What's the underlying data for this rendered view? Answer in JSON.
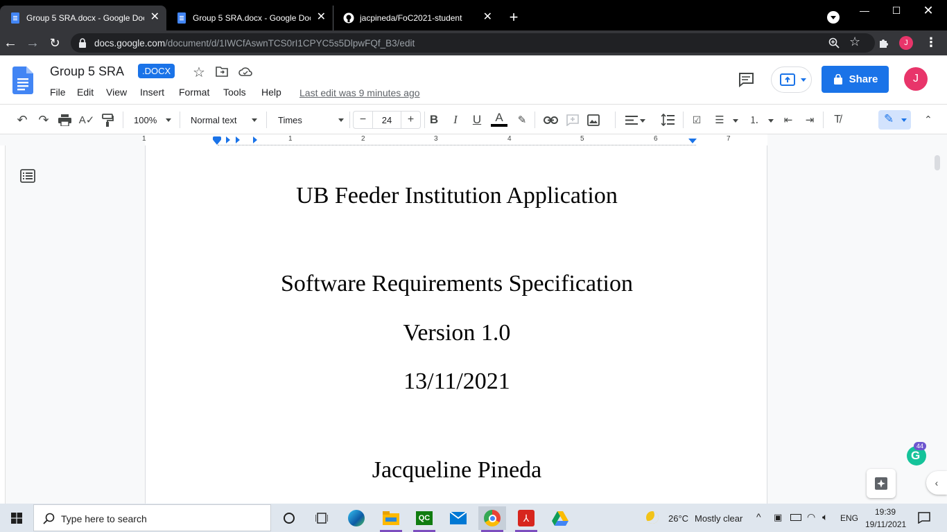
{
  "browser": {
    "tabs": [
      {
        "title": "Group 5 SRA.docx - Google Docs",
        "active": true
      },
      {
        "title": "Group 5 SRA.docx - Google Docs",
        "active": false
      },
      {
        "title": "jacpineda/FoC2021-student",
        "active": false
      }
    ],
    "new_tab_label": "+",
    "url_host": "docs.google.com",
    "url_path": "/document/d/1IWCfAswnTCS0rI1CPYC5s5DlpwFQf_B3/edit",
    "profile_initial": "J"
  },
  "docs": {
    "title": "Group 5 SRA",
    "badge": ".DOCX",
    "menu": [
      "File",
      "Edit",
      "View",
      "Insert",
      "Format",
      "Tools",
      "Help"
    ],
    "last_edit": "Last edit was 9 minutes ago",
    "share_label": "Share",
    "avatar_initial": "J",
    "accent_color": "#1a73e8"
  },
  "toolbar": {
    "zoom": "100%",
    "style": "Normal text",
    "font": "Times",
    "font_size": "24",
    "minus": "−",
    "plus": "+",
    "bold": "B",
    "italic": "I",
    "underline": "U",
    "text_color": "A"
  },
  "ruler": {
    "numbers": [
      "1",
      "1",
      "2",
      "3",
      "4",
      "5",
      "6",
      "7"
    ]
  },
  "document": {
    "lines": [
      "UB Feeder Institution Application",
      "Software Requirements Specification",
      "Version 1.0",
      "13/11/2021",
      "Jacqueline Pineda"
    ]
  },
  "grammarly": {
    "count": "44"
  },
  "taskbar": {
    "search_placeholder": "Type here to search",
    "weather_temp": "26°C",
    "weather_desc": "Mostly clear",
    "language": "ENG",
    "time": "19:39",
    "date": "19/11/2021"
  }
}
